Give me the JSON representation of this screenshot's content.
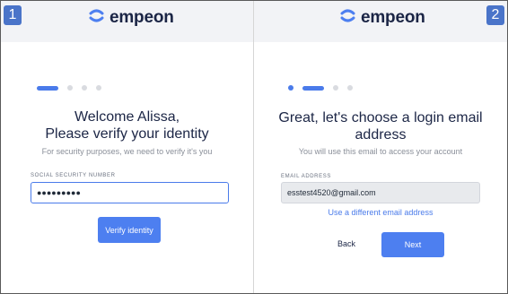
{
  "colors": {
    "accent": "#4d7ff0",
    "brand_text": "#1b2545",
    "badge": "#4a74c9"
  },
  "step1": {
    "badge": "1",
    "logo_text": "empeon",
    "logo_icon": "empeon-logo-icon",
    "progress": {
      "steps": 4,
      "current": 1
    },
    "title_line1": "Welcome Alissa,",
    "title_line2": "Please verify your identity",
    "subtitle": "For security purposes, we need to verify it's you",
    "field_label": "SOCIAL SECURITY NUMBER",
    "field_value": "●●●●●●●●●",
    "button": "Verify identity"
  },
  "step2": {
    "badge": "2",
    "logo_text": "empeon",
    "logo_icon": "empeon-logo-icon",
    "progress": {
      "steps": 4,
      "current": 2
    },
    "title_line1": "Great, let's choose a login email",
    "title_line2": "address",
    "subtitle": "You will use this email to access your account",
    "field_label": "EMAIL ADDRESS",
    "field_value": "esstest4520@gmail.com",
    "link": "Use a different email address",
    "back_button": "Back",
    "next_button": "Next"
  }
}
